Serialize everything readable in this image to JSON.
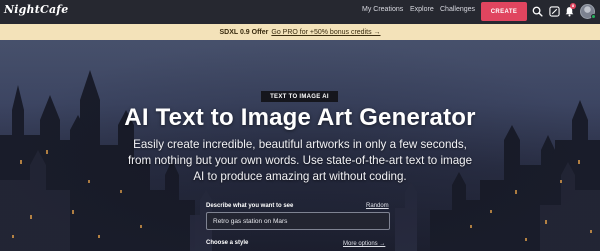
{
  "brand": {
    "logo_text": "NightCafe"
  },
  "nav": {
    "links": [
      "My Creations",
      "Explore",
      "Challenges"
    ],
    "create_label": "CREATE",
    "notification_count": "8",
    "icons": [
      "search-icon",
      "gallery-icon",
      "bell-icon",
      "avatar"
    ]
  },
  "promo": {
    "label": "SDXL 0.9 Offer",
    "link_text": "Go PRO for +50% bonus credits →"
  },
  "hero": {
    "tag": "TEXT TO IMAGE AI",
    "title": "AI Text to Image Art Generator",
    "subtitle": "Easily create incredible, beautiful artworks in only a few seconds, from nothing but your own words. Use state-of-the-art text to image AI to produce amazing art without coding."
  },
  "form": {
    "prompt_label": "Describe what you want to see",
    "random_label": "Random",
    "prompt_value": "Retro gas station on Mars",
    "style_label": "Choose a style",
    "more_options_label": "More options →"
  },
  "colors": {
    "navbar_bg": "#262830",
    "accent": "#e0455f",
    "promo_bg": "#f3e2b9"
  }
}
